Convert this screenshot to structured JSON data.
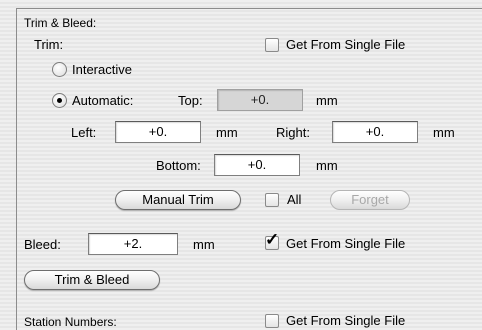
{
  "trim_bleed": {
    "title": "Trim & Bleed:",
    "trim_label": "Trim:",
    "get_from_single_file_trim": {
      "label": "Get From Single File",
      "checked": false
    },
    "interactive_label": "Interactive",
    "automatic_label": "Automatic:",
    "mode_selected": "Automatic",
    "top_label": "Top:",
    "top_value": "+0.",
    "top_unit": "mm",
    "left_label": "Left:",
    "left_value": "+0.",
    "left_unit": "mm",
    "right_label": "Right:",
    "right_value": "+0.",
    "right_unit": "mm",
    "bottom_label": "Bottom:",
    "bottom_value": "+0.",
    "bottom_unit": "mm",
    "manual_trim_label": "Manual Trim",
    "all_label": "All",
    "all_checked": false,
    "forget_label": "Forget",
    "bleed_label": "Bleed:",
    "bleed_value": "+2.",
    "bleed_unit": "mm",
    "get_from_single_file_bleed": {
      "label": "Get From Single File",
      "checked": true
    },
    "trim_and_bleed_button": "Trim & Bleed"
  },
  "station_numbers": {
    "title": "Station Numbers:",
    "get_from_single_file": {
      "label": "Get From Single File",
      "checked": false
    }
  }
}
